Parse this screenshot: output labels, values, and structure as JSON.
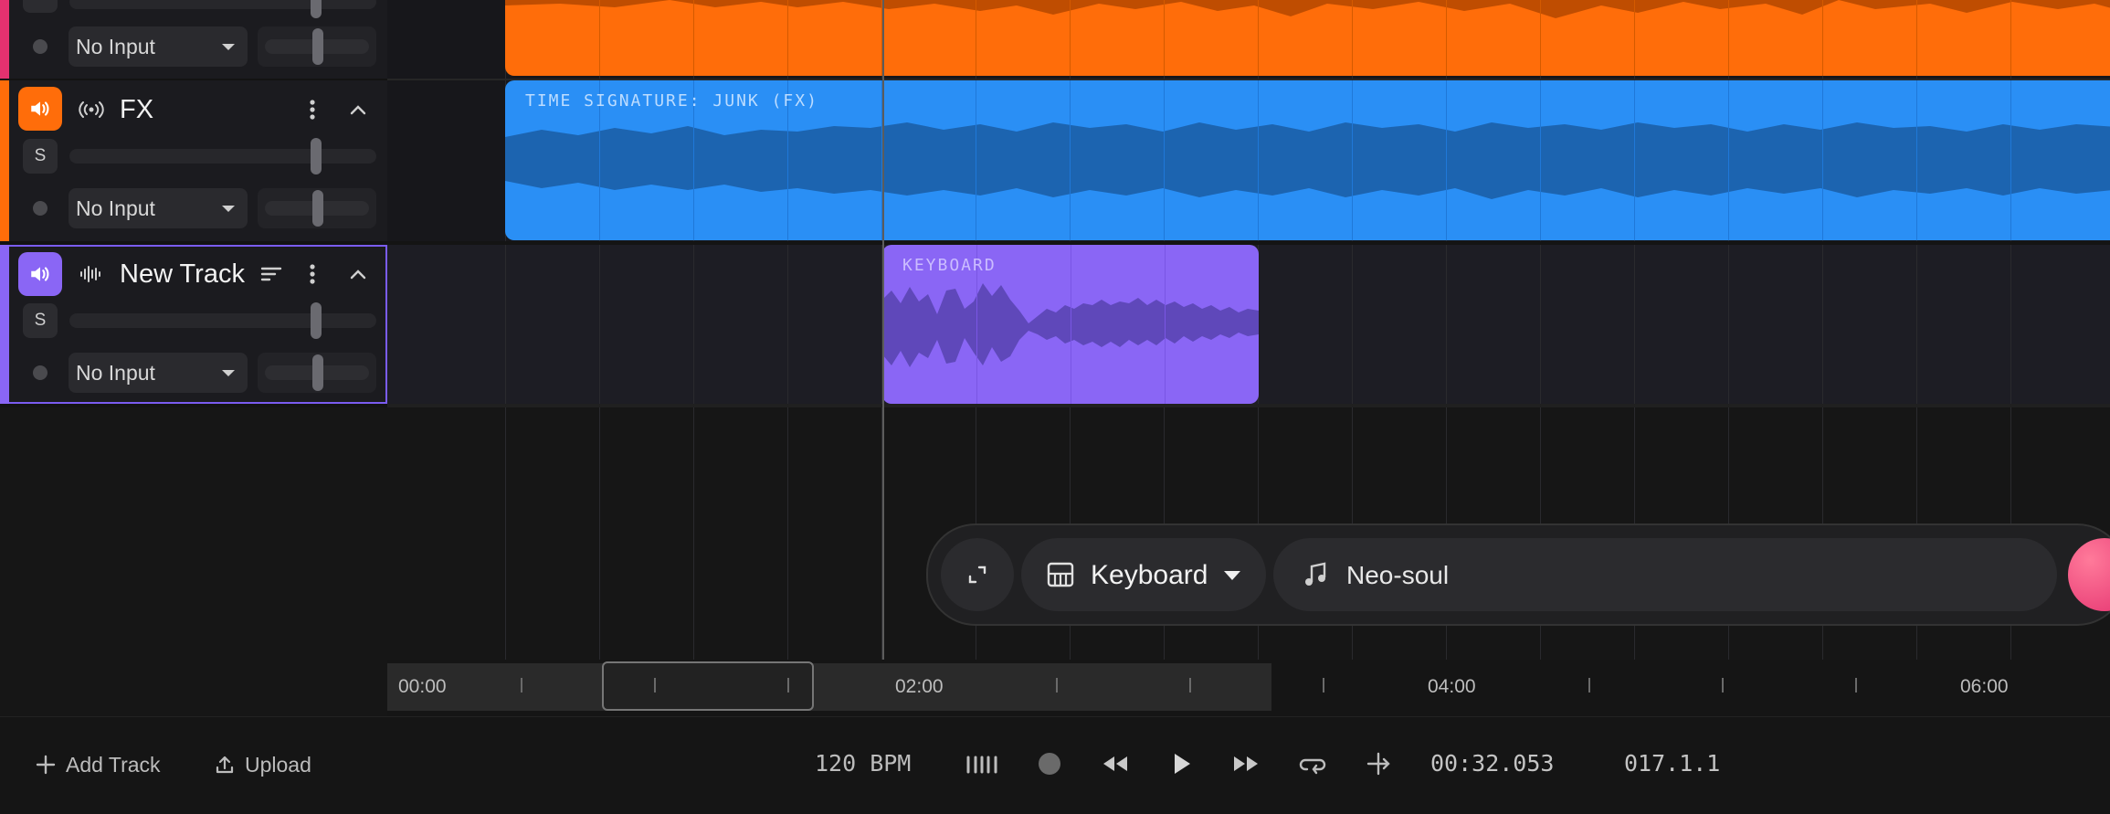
{
  "colors": {
    "orange": "#ff6d0a",
    "blue": "#2a8ff5",
    "purple": "#8a66f5",
    "pink": "#e4316f"
  },
  "tracks": [
    {
      "name": "",
      "input": "No Input",
      "solo": "S"
    },
    {
      "name": "FX",
      "input": "No Input",
      "solo": "S",
      "icon": "broadcast-icon",
      "clip": "TIME SIGNATURE: JUNK (FX)"
    },
    {
      "name": "New Track",
      "input": "No Input",
      "solo": "S",
      "icon": "waveform-icon",
      "clip": "KEYBOARD"
    }
  ],
  "ruler": {
    "labels": [
      "00:00",
      "02:00",
      "04:00",
      "06:00"
    ]
  },
  "prompt": {
    "instrument": "Keyboard",
    "genre": "Neo-soul"
  },
  "footer": {
    "add_track": "Add Track",
    "upload": "Upload",
    "bpm": "120 BPM",
    "time": "00:32.053",
    "position": "017.1.1"
  }
}
